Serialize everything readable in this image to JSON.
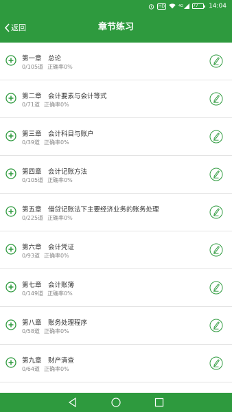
{
  "status_bar": {
    "time": "14:04",
    "hd_label": "HD",
    "signal_label": "4G",
    "battery": "77"
  },
  "header": {
    "back_label": "返回",
    "title": "章节练习"
  },
  "chapters": [
    {
      "title": "第一章　总论",
      "progress": "0/105道",
      "accuracy": "正确率0%"
    },
    {
      "title": "第二章　会计要素与会计等式",
      "progress": "0/71道",
      "accuracy": "正确率0%"
    },
    {
      "title": "第三章　会计科目与账户",
      "progress": "0/39道",
      "accuracy": "正确率0%"
    },
    {
      "title": "第四章　会计记账方法",
      "progress": "0/105道",
      "accuracy": "正确率0%"
    },
    {
      "title": "第五章　借贷记账法下主要经济业务的账务处理",
      "progress": "0/225道",
      "accuracy": "正确率0%"
    },
    {
      "title": "第六章　会计凭证",
      "progress": "0/93道",
      "accuracy": "正确率0%"
    },
    {
      "title": "第七章　会计账簿",
      "progress": "0/149道",
      "accuracy": "正确率0%"
    },
    {
      "title": "第八章　账务处理程序",
      "progress": "0/58道",
      "accuracy": "正确率0%"
    },
    {
      "title": "第九章　财产清查",
      "progress": "0/64道",
      "accuracy": "正确率0%"
    }
  ],
  "colors": {
    "brand_green": "#2e9a3e",
    "icon_green": "#2e9a3e"
  },
  "icons": {
    "expand": "plus-circle-icon",
    "edit": "pencil-circle-icon",
    "back": "chevron-left-icon"
  }
}
